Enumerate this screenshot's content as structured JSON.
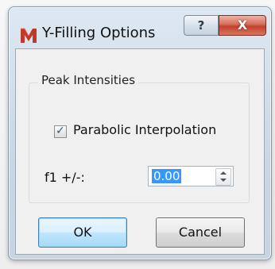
{
  "window": {
    "title": "Y-Filling Options",
    "help_glyph": "?",
    "close_glyph": "X"
  },
  "group": {
    "title": "Peak Intensities"
  },
  "parabolic": {
    "label": "Parabolic Interpolation",
    "checked": true,
    "check_glyph": "✓"
  },
  "f1": {
    "label": "f1 +/-:",
    "value": "0.00"
  },
  "buttons": {
    "ok": "OK",
    "cancel": "Cancel"
  },
  "colors": {
    "selection": "#3399ff",
    "close_button": "#c2412b",
    "app_icon": "#c0392b"
  },
  "icons": {
    "app": "m-logo-icon",
    "spin_up": "triangle-up-icon",
    "spin_down": "triangle-down-icon"
  }
}
